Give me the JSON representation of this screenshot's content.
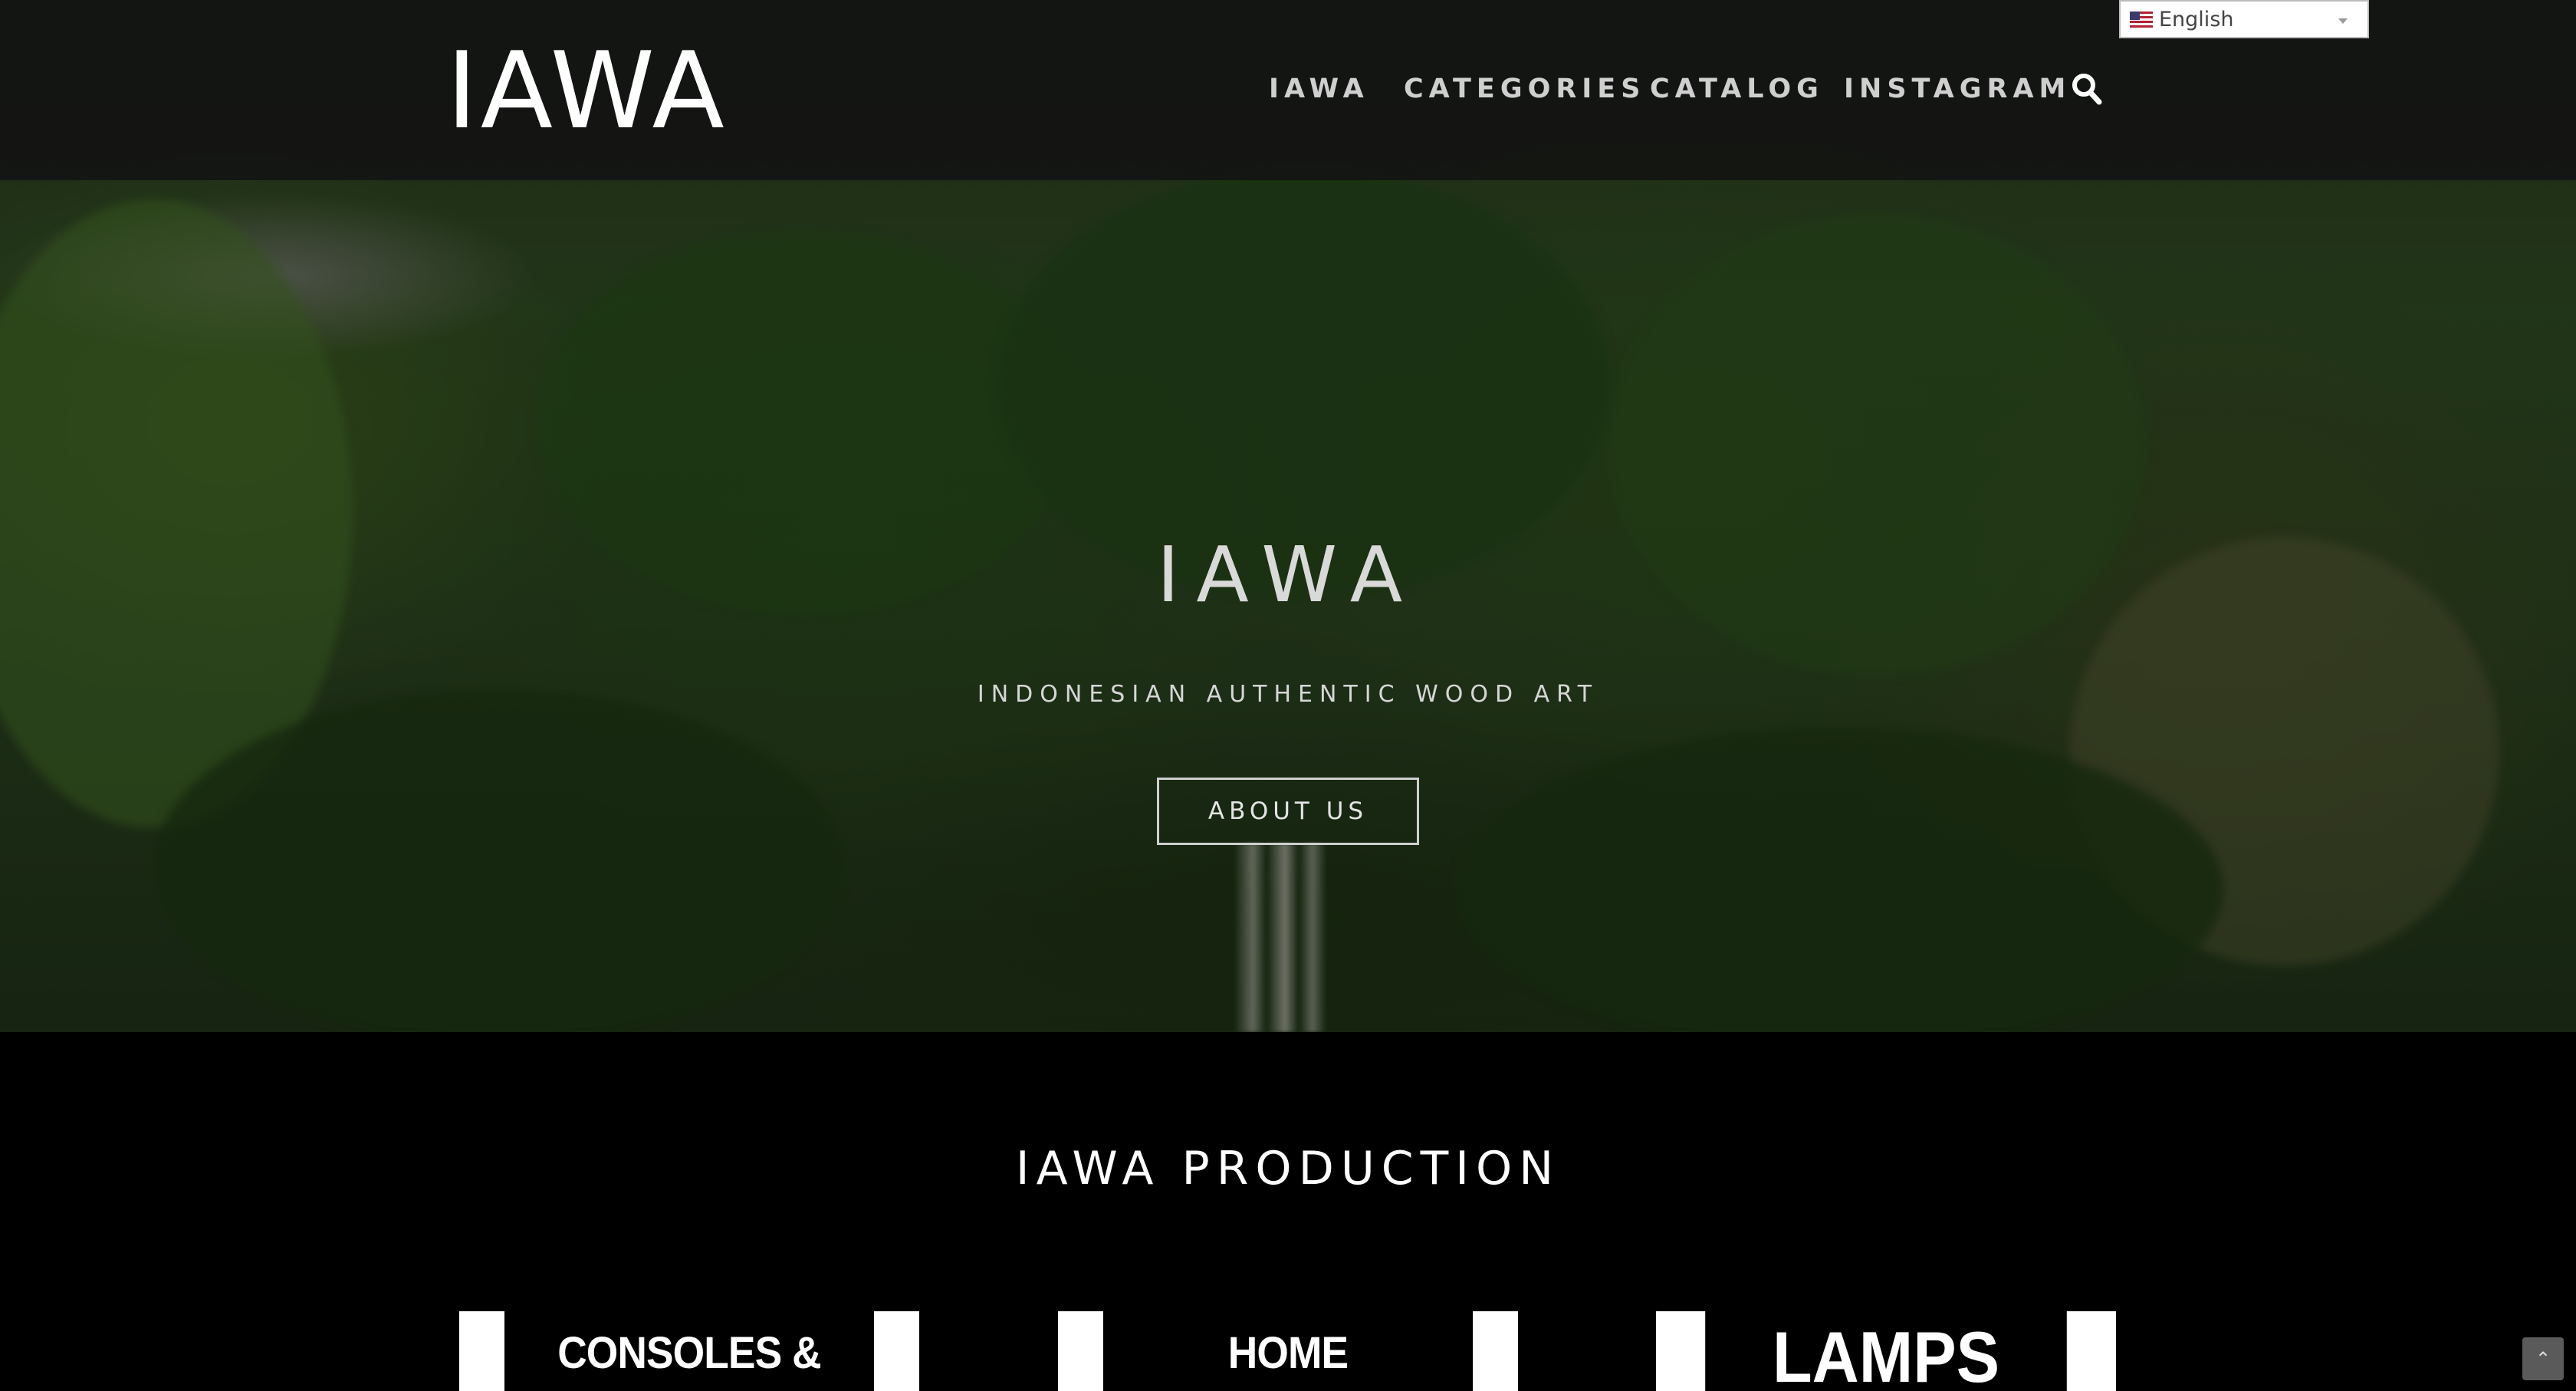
{
  "header": {
    "logo": "IAWA",
    "nav": [
      {
        "label": "IAWA"
      },
      {
        "label": "CATEGORIES"
      },
      {
        "label": "CATALOG"
      },
      {
        "label": "INSTAGRAM"
      }
    ],
    "search_icon": "search-icon",
    "language": {
      "selected": "English",
      "flag_icon": "us-flag-icon"
    }
  },
  "hero": {
    "title": "IAWA",
    "subtitle": "INDONESIAN AUTHENTIC WOOD ART",
    "button_label": "ABOUT US"
  },
  "production": {
    "title": "IAWA PRODUCTION",
    "cards": [
      {
        "label": "CONSOLES & TABLES"
      },
      {
        "label": "HOME DECORATION"
      },
      {
        "label": "LAMPS"
      }
    ]
  },
  "scroll_top_icon": "double-chevron-up-icon",
  "colors": {
    "header_bg": "#121212",
    "nav_text": "#cfcfcf",
    "page_bg": "#000000",
    "accent_white": "#ffffff"
  }
}
